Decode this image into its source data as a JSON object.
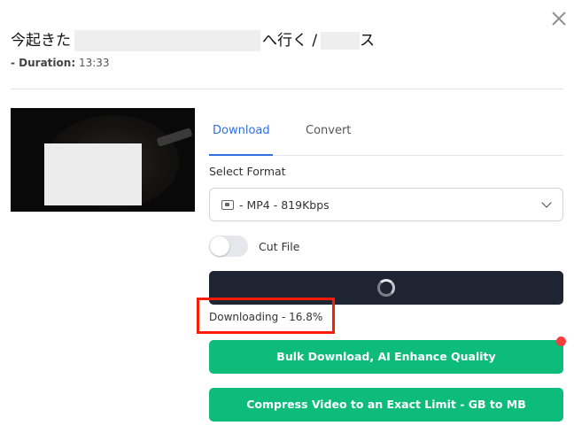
{
  "header": {
    "title_prefix": "今起きた",
    "title_middle": "へ行く / ",
    "title_suffix": "ス",
    "duration_label": "- Duration:",
    "duration_value": "13:33"
  },
  "tabs": [
    {
      "label": "Download",
      "active": true
    },
    {
      "label": "Convert",
      "active": false
    }
  ],
  "format": {
    "label": "Select Format",
    "selected": "- MP4 - 819Kbps",
    "icon": "video-file-icon"
  },
  "cut_file": {
    "label": "Cut File",
    "enabled": false
  },
  "download": {
    "status": "Downloading - 16.8%",
    "progress_percent": 16.8
  },
  "actions": {
    "bulk_label": "Bulk Download, AI Enhance Quality",
    "compress_label": "Compress Video to an Exact Limit - GB to MB"
  },
  "colors": {
    "accent": "#2f6fdf",
    "dark_button": "#1e2432",
    "green_button": "#0dbb7a",
    "highlight": "#ff1a00",
    "notify_dot": "#f43f3f"
  }
}
